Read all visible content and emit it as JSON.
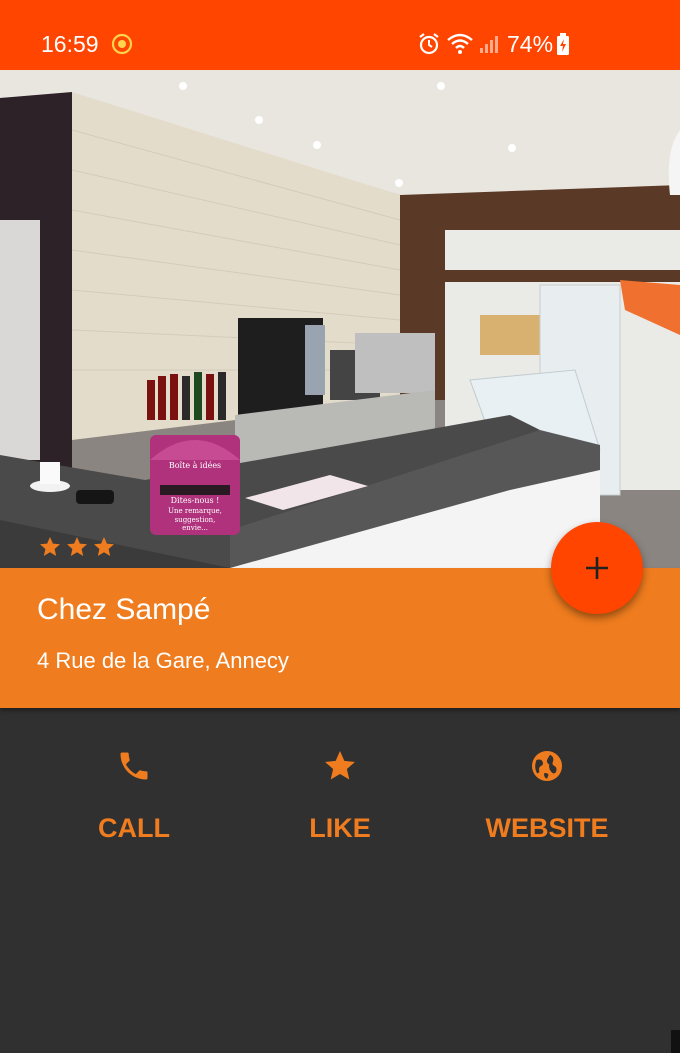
{
  "status_bar": {
    "time": "16:59",
    "battery": "74%",
    "icons": [
      "app-notification-icon",
      "alarm-icon",
      "wifi-icon",
      "signal-icon",
      "battery-icon"
    ]
  },
  "place": {
    "name": "Chez Sampé",
    "address": "4 Rue de la Gare, Annecy",
    "rating": 3
  },
  "photo": {
    "sign_lines": [
      "Boîte à idées",
      "Dites-nous !",
      "Une remarque,",
      "suggestion,",
      "envie..."
    ]
  },
  "fab": {
    "icon": "plus-icon"
  },
  "actions": [
    {
      "label": "CALL",
      "icon": "phone-icon"
    },
    {
      "label": "LIKE",
      "icon": "star-icon"
    },
    {
      "label": "WEBSITE",
      "icon": "globe-icon"
    }
  ],
  "colors": {
    "status_bar": "#FF4500",
    "accent": "#EF7C1E",
    "fab": "#FF4500",
    "background": "#303030"
  }
}
